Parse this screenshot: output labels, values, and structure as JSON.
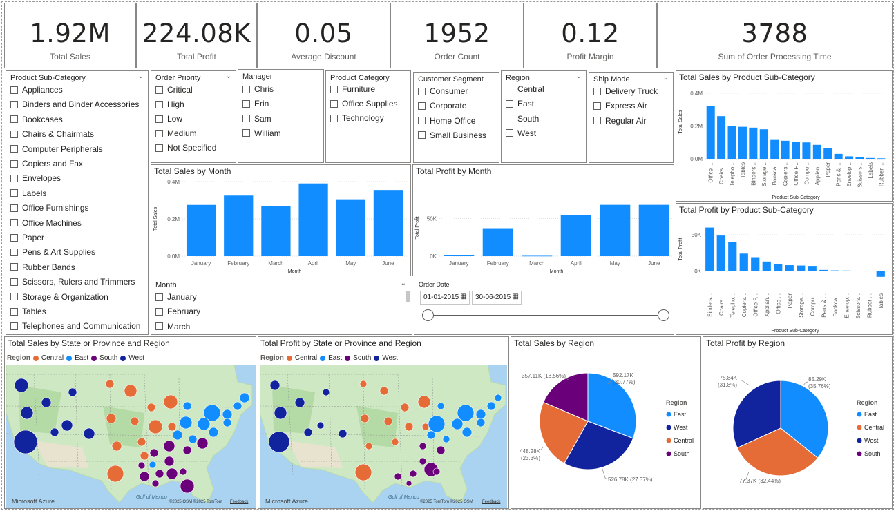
{
  "kpis": [
    {
      "value": "1.92M",
      "label": "Total Sales"
    },
    {
      "value": "224.08K",
      "label": "Total Profit"
    },
    {
      "value": "0.05",
      "label": "Average Discount"
    },
    {
      "value": "1952",
      "label": "Order Count"
    },
    {
      "value": "0.12",
      "label": "Profit Margin"
    },
    {
      "value": "3788",
      "label": "Sum of Order Processing Time"
    }
  ],
  "slicers": {
    "sub_category": {
      "title": "Product Sub-Category",
      "items": [
        "Appliances",
        "Binders and Binder Accessories",
        "Bookcases",
        "Chairs & Chairmats",
        "Computer Peripherals",
        "Copiers and Fax",
        "Envelopes",
        "Labels",
        "Office Furnishings",
        "Office Machines",
        "Paper",
        "Pens & Art Supplies",
        "Rubber Bands",
        "Scissors, Rulers and Trimmers",
        "Storage & Organization",
        "Tables",
        "Telephones and Communication"
      ]
    },
    "order_priority": {
      "title": "Order Priority",
      "items": [
        "Critical",
        "High",
        "Low",
        "Medium",
        "Not Specified"
      ]
    },
    "manager": {
      "title": "Manager",
      "items": [
        "Chris",
        "Erin",
        "Sam",
        "William"
      ]
    },
    "product_category": {
      "title": "Product Category",
      "items": [
        "Furniture",
        "Office Supplies",
        "Technology"
      ]
    },
    "customer_segment": {
      "title": "Customer Segment",
      "items": [
        "Consumer",
        "Corporate",
        "Home Office",
        "Small Business"
      ]
    },
    "region": {
      "title": "Region",
      "items": [
        "Central",
        "East",
        "South",
        "West"
      ]
    },
    "ship_mode": {
      "title": "Ship Mode",
      "items": [
        "Delivery Truck",
        "Express Air",
        "Regular Air"
      ]
    },
    "month": {
      "title": "Month",
      "items": [
        "January",
        "February",
        "March"
      ]
    },
    "order_date": {
      "title": "Order Date",
      "start": "01-01-2015",
      "end": "30-06-2015"
    }
  },
  "map_legend": {
    "title": "Region",
    "items": [
      "Central",
      "East",
      "South",
      "West"
    ]
  },
  "map_footer": {
    "brand": "Microsoft Azure",
    "gulf": "Gulf of Mexico",
    "credit1": "©2025 OSM ©2025 TomTom",
    "credit2": "©2025 TomTom ©2025 OSM",
    "feedback": "Feedback"
  },
  "colors": {
    "bar": "#118DFF",
    "east": "#118DFF",
    "west": "#12239E",
    "central": "#E66C37",
    "south": "#6B007B"
  },
  "chart_data": [
    {
      "id": "sales_by_month",
      "type": "bar",
      "title": "Total Sales by Month",
      "xlabel": "Month",
      "ylabel": "Total Sales",
      "categories": [
        "January",
        "February",
        "March",
        "April",
        "May",
        "June"
      ],
      "values": [
        0.275,
        0.325,
        0.27,
        0.39,
        0.305,
        0.355
      ],
      "ylim": [
        0,
        0.4
      ],
      "yticks": [
        0,
        0.2,
        0.4
      ],
      "ytick_labels": [
        "0.0M",
        "0.2M",
        "0.4M"
      ]
    },
    {
      "id": "profit_by_month",
      "type": "bar",
      "title": "Total Profit by Month",
      "xlabel": "Month",
      "ylabel": "Total Profit",
      "categories": [
        "January",
        "February",
        "March",
        "April",
        "May",
        "June"
      ],
      "values": [
        1000,
        37000,
        500,
        54000,
        68000,
        68000
      ],
      "ylim": [
        0,
        75000
      ],
      "yticks": [
        0,
        50000
      ],
      "ytick_labels": [
        "0K",
        "50K"
      ]
    },
    {
      "id": "sales_by_subcat",
      "type": "bar",
      "title": "Total Sales by Product Sub-Category",
      "xlabel": "Product Sub-Category",
      "ylabel": "Total Sales",
      "categories": [
        "Office ...",
        "Chairs ...",
        "Telepho...",
        "Tables",
        "Binders...",
        "Storage...",
        "Bookca...",
        "Copiers...",
        "Office F...",
        "Compu...",
        "Applian...",
        "Paper",
        "Pens & ...",
        "Envelop...",
        "Scissors...",
        "Labels",
        "Rubber ..."
      ],
      "values": [
        0.32,
        0.26,
        0.2,
        0.195,
        0.19,
        0.18,
        0.115,
        0.11,
        0.105,
        0.1,
        0.085,
        0.065,
        0.03,
        0.015,
        0.01,
        0.005,
        0.003
      ],
      "ylim": [
        0,
        0.45
      ],
      "yticks": [
        0,
        0.2,
        0.4
      ],
      "ytick_labels": [
        "0.0M",
        "0.2M",
        "0.4M"
      ]
    },
    {
      "id": "profit_by_subcat",
      "type": "bar",
      "title": "Total Profit by Product Sub-Category",
      "xlabel": "Product Sub-Category",
      "ylabel": "Total Profit",
      "categories": [
        "Binders...",
        "Chairs ...",
        "Telepho...",
        "Copiers...",
        "Office F...",
        "Applian...",
        "Office ...",
        "Paper",
        "Storage...",
        "Compu...",
        "Pens & ...",
        "Bookca...",
        "Envelop...",
        "Scissors...",
        "Rubber ...",
        "Tables"
      ],
      "values": [
        60000,
        49000,
        40000,
        24000,
        19000,
        13000,
        9000,
        8000,
        7500,
        7000,
        1500,
        800,
        600,
        400,
        200,
        -8000
      ],
      "ylim": [
        -12000,
        72000
      ],
      "yticks": [
        0,
        50000
      ],
      "ytick_labels": [
        "0K",
        "50K"
      ]
    },
    {
      "id": "sales_by_region",
      "type": "pie",
      "title": "Total Sales by Region",
      "legend_title": "Region",
      "legend": [
        "East",
        "West",
        "Central",
        "South"
      ],
      "slices": [
        {
          "name": "East",
          "value": 592170,
          "label1": "592.17K",
          "label2": "(30.77%)"
        },
        {
          "name": "West",
          "value": 526780,
          "label1": "526.78K (27.37%)",
          "label2": ""
        },
        {
          "name": "Central",
          "value": 448280,
          "label1": "448.28K",
          "label2": "(23.3%)"
        },
        {
          "name": "South",
          "value": 357110,
          "label1": "357.11K (18.56%)",
          "label2": ""
        }
      ]
    },
    {
      "id": "profit_by_region",
      "type": "pie",
      "title": "Total Profit by Region",
      "legend_title": "Region",
      "legend": [
        "East",
        "Central",
        "West",
        "South"
      ],
      "slices": [
        {
          "name": "East",
          "value": 85290,
          "label1": "85.29K",
          "label2": "(35.76%)"
        },
        {
          "name": "Central",
          "value": 77370,
          "label1": "77.37K (32.44%)",
          "label2": ""
        },
        {
          "name": "West",
          "value": 75840,
          "label1": "75.84K",
          "label2": "(31.8%)"
        },
        {
          "name": "South",
          "value": 0,
          "label1": "",
          "label2": ""
        }
      ]
    },
    {
      "id": "sales_map",
      "type": "scatter",
      "title": "Total Sales by State or Province and Region"
    },
    {
      "id": "profit_map",
      "type": "scatter",
      "title": "Total Profit by State or Province and Region"
    }
  ]
}
